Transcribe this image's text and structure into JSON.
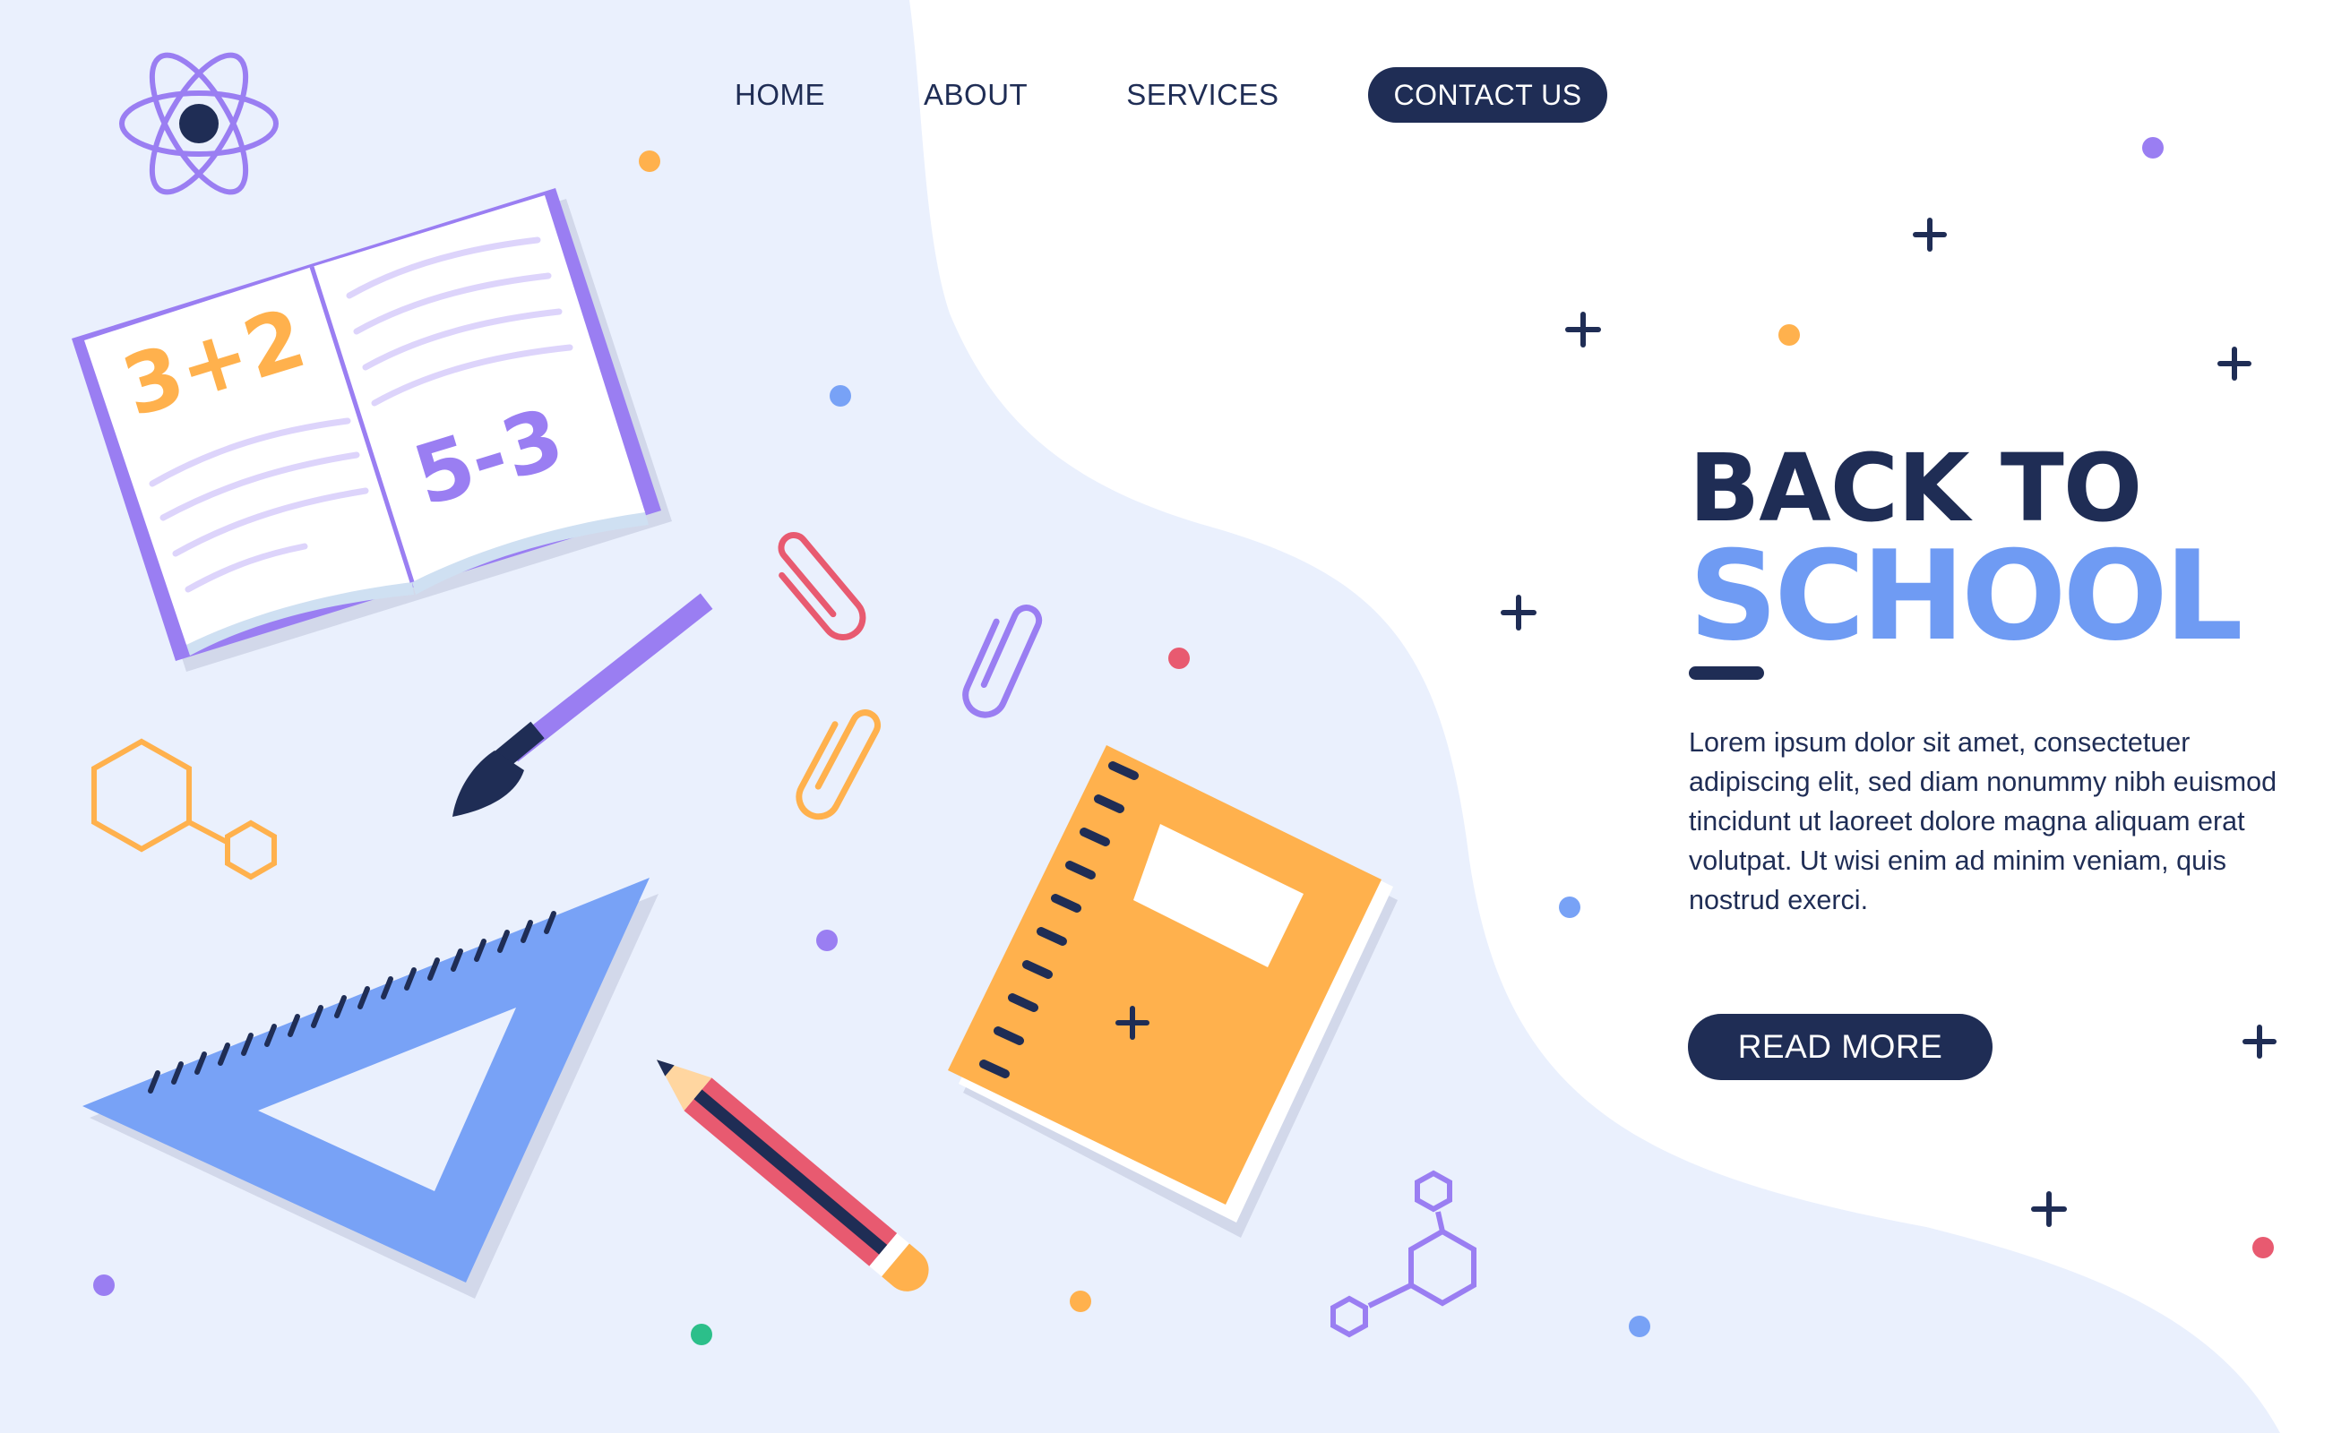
{
  "nav": {
    "items": [
      {
        "label": "HOME"
      },
      {
        "label": "ABOUT"
      },
      {
        "label": "SERVICES"
      }
    ],
    "contact_label": "CONTACT US"
  },
  "hero": {
    "title_line1": "BACK TO",
    "title_line2": "SCHOOL",
    "description": "Lorem ipsum dolor sit amet, consectetuer adipiscing elit, sed diam nonummy nibh euismod tincidunt ut laoreet dolore magna aliquam erat volutpat. Ut wisi enim ad minim veniam, quis nostrud exerci.",
    "read_more_label": "READ MORE"
  },
  "illustration": {
    "book_left_text": "3+2",
    "book_right_text": "5-3",
    "icons": [
      "atom-icon",
      "open-book-icon",
      "paintbrush-icon",
      "paperclip-icon",
      "hexagon-molecule-icon",
      "set-square-ruler-icon",
      "pencil-icon",
      "notebook-icon",
      "plus-icon",
      "dot-icon"
    ]
  },
  "colors": {
    "navy": "#1f2d55",
    "blue": "#6f9bf3",
    "purple": "#9a7ef2",
    "orange": "#ffb14d",
    "red": "#e85a70",
    "green": "#2cbf8a",
    "background_blob": "#eaf0fd"
  }
}
